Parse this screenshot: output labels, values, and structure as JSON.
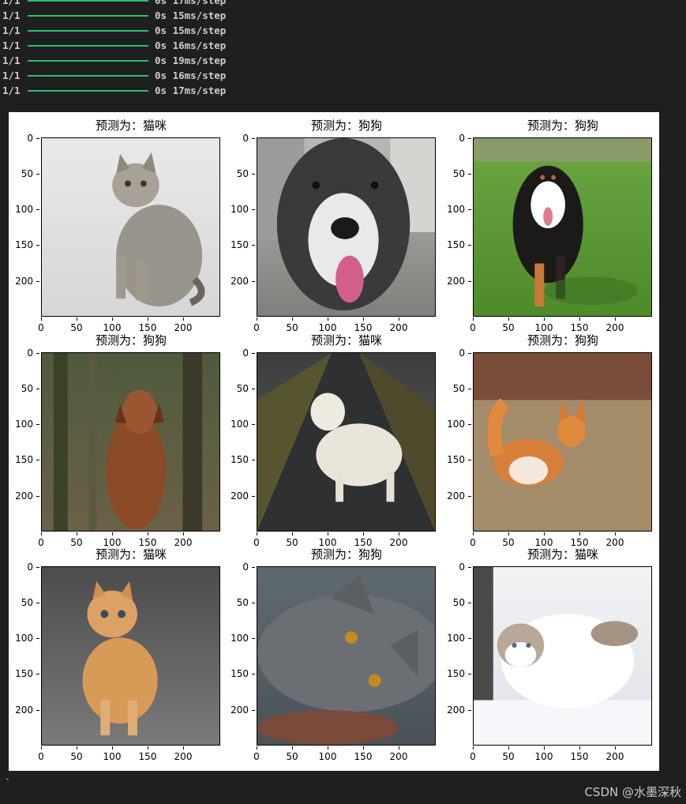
{
  "log": [
    {
      "step": "1/1",
      "time": "0s 17ms/step"
    },
    {
      "step": "1/1",
      "time": "0s 15ms/step"
    },
    {
      "step": "1/1",
      "time": "0s 15ms/step"
    },
    {
      "step": "1/1",
      "time": "0s 16ms/step"
    },
    {
      "step": "1/1",
      "time": "0s 19ms/step"
    },
    {
      "step": "1/1",
      "time": "0s 16ms/step"
    },
    {
      "step": "1/1",
      "time": "0s 17ms/step"
    }
  ],
  "ticks": {
    "y": [
      "0",
      "50",
      "100",
      "150",
      "200"
    ],
    "x": [
      "0",
      "50",
      "100",
      "150",
      "200"
    ]
  },
  "panels": [
    {
      "title": "预测为：猫咪",
      "subject": "tabby-cat",
      "bg": [
        "#e9e9e9",
        "#d6d6d6"
      ],
      "fg": "#9a958c"
    },
    {
      "title": "预测为：狗狗",
      "subject": "pointer-dog",
      "bg": [
        "#b8b8b4",
        "#7f7f7c"
      ],
      "fg": "#3a3a3d"
    },
    {
      "title": "预测为：狗狗",
      "subject": "bernese-dog",
      "bg": [
        "#6aa641",
        "#4f8a2b"
      ],
      "fg": "#1c1a18"
    },
    {
      "title": "预测为：狗狗",
      "subject": "retriever-forest",
      "bg": [
        "#4f5a3c",
        "#6b6147"
      ],
      "fg": "#8a4a25"
    },
    {
      "title": "预测为：猫咪",
      "subject": "white-dog-road",
      "bg": [
        "#3d3f3f",
        "#5b5d5b"
      ],
      "fg": "#e9e5db"
    },
    {
      "title": "预测为：狗狗",
      "subject": "corgi-field",
      "bg": [
        "#8c6e5a",
        "#b29a7a"
      ],
      "fg": "#d7803a"
    },
    {
      "title": "预测为：猫咪",
      "subject": "ginger-kitten",
      "bg": [
        "#4c4c4c",
        "#7a7a7a"
      ],
      "fg": "#d89a57"
    },
    {
      "title": "预测为：狗狗",
      "subject": "grey-cat-lying",
      "bg": [
        "#5f6a70",
        "#4b5257"
      ],
      "fg": "#6b6f74"
    },
    {
      "title": "预测为：猫咪",
      "subject": "ragdoll-cat-snow",
      "bg": [
        "#f2f2f4",
        "#dfe2e8"
      ],
      "fg": "#b8a898"
    }
  ],
  "watermark": "CSDN @水墨深秋"
}
